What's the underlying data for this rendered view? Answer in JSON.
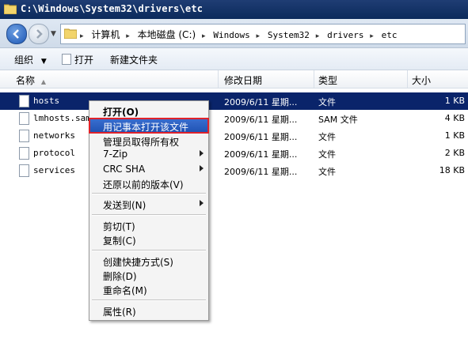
{
  "window": {
    "title": "C:\\Windows\\System32\\drivers\\etc"
  },
  "address": {
    "crumbs": [
      "计算机",
      "本地磁盘 (C:)",
      "Windows",
      "System32",
      "drivers",
      "etc"
    ]
  },
  "toolbar": {
    "organize": "组织",
    "open": "打开",
    "new_folder": "新建文件夹"
  },
  "columns": {
    "name": "名称",
    "modified": "修改日期",
    "type": "类型",
    "size": "大小"
  },
  "files": [
    {
      "name": "hosts",
      "modified": "2009/6/11 星期...",
      "type": "文件",
      "size": "1 KB"
    },
    {
      "name": "lmhosts.sam",
      "modified": "2009/6/11 星期...",
      "type": "SAM 文件",
      "size": "4 KB"
    },
    {
      "name": "networks",
      "modified": "2009/6/11 星期...",
      "type": "文件",
      "size": "1 KB"
    },
    {
      "name": "protocol",
      "modified": "2009/6/11 星期...",
      "type": "文件",
      "size": "2 KB"
    },
    {
      "name": "services",
      "modified": "2009/6/11 星期...",
      "type": "文件",
      "size": "18 KB"
    }
  ],
  "context_menu": {
    "open": "打开(O)",
    "open_notepad": "用记事本打开该文件",
    "take_ownership": "管理员取得所有权",
    "sevenzip": "7-Zip",
    "crc_sha": "CRC SHA",
    "restore": "还原以前的版本(V)",
    "send_to": "发送到(N)",
    "cut": "剪切(T)",
    "copy": "复制(C)",
    "create_shortcut": "创建快捷方式(S)",
    "delete": "删除(D)",
    "rename": "重命名(M)",
    "properties": "属性(R)"
  },
  "colors": {
    "title_bar": "#0b2a5c",
    "selection": "#0a246a",
    "menu_highlight": "#1f52b3",
    "annotation_box": "#e0222a"
  }
}
